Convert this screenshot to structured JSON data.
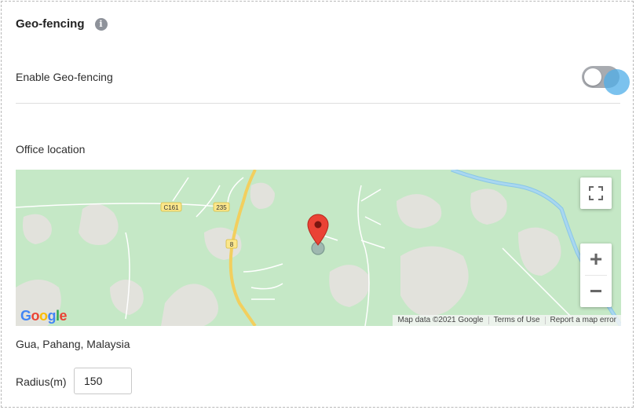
{
  "section": {
    "title": "Geo-fencing",
    "info_icon": "info-icon"
  },
  "geofence": {
    "enable_label": "Enable Geo-fencing",
    "enabled": false
  },
  "office": {
    "label": "Office location",
    "address": "Gua, Pahang, Malaysia"
  },
  "map": {
    "road_labels": [
      "C161",
      "235",
      "8"
    ],
    "logo_letters": [
      "G",
      "o",
      "o",
      "g",
      "l",
      "e"
    ],
    "logo_colors": [
      "#4285F4",
      "#EA4335",
      "#FBBC05",
      "#4285F4",
      "#34A853",
      "#EA4335"
    ],
    "attribution": {
      "map_data": "Map data ©2021 Google",
      "terms": "Terms of Use",
      "report": "Report a map error"
    },
    "controls": {
      "fullscreen_icon": "fullscreen-icon",
      "zoom_in": "+",
      "zoom_out": "−"
    },
    "pin_color": "#EA4335"
  },
  "radius": {
    "label": "Radius(m)",
    "value": "150"
  },
  "colors": {
    "accent": "#4FADE8",
    "map_green": "#C5E8C6"
  }
}
